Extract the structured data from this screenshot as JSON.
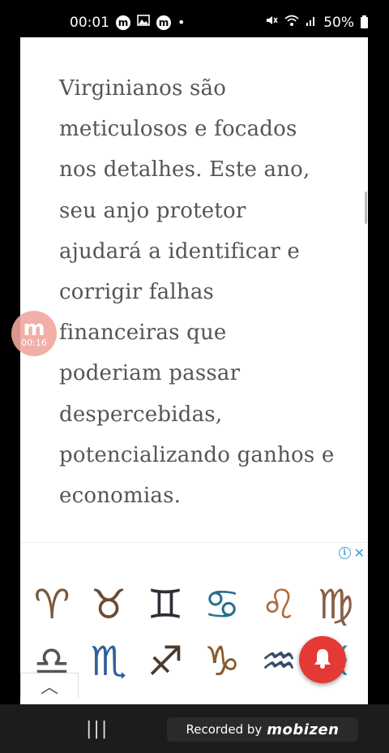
{
  "status_bar": {
    "time": "00:01",
    "dot": "•",
    "battery": "50%",
    "left_icons": [
      "mobizen-icon",
      "gallery-icon",
      "mobizen-icon"
    ],
    "right_icons": [
      "mute-icon",
      "wifi-icon",
      "signal-icon",
      "battery-icon"
    ],
    "badge_letter": "m"
  },
  "article": {
    "text": "Virginianos são meticulosos e focados nos detalhes. Este ano, seu anjo protetor ajudará a identificar e corrigir falhas financeiras que poderiam passar despercebidas, potencializando ganhos e economias."
  },
  "ad": {
    "info_glyph": "i",
    "close_glyph": "✕",
    "zodiac": [
      {
        "name": "aries-icon",
        "glyph": "♈"
      },
      {
        "name": "taurus-icon",
        "glyph": "♉"
      },
      {
        "name": "gemini-icon",
        "glyph": "♊"
      },
      {
        "name": "cancer-icon",
        "glyph": "♋"
      },
      {
        "name": "leo-icon",
        "glyph": "♌"
      },
      {
        "name": "virgo-icon",
        "glyph": "♍"
      },
      {
        "name": "libra-icon",
        "glyph": "♎"
      },
      {
        "name": "scorpio-icon",
        "glyph": "♏"
      },
      {
        "name": "sagittarius-icon",
        "glyph": "♐"
      },
      {
        "name": "capricorn-icon",
        "glyph": "♑"
      },
      {
        "name": "aquarius-icon",
        "glyph": "♒"
      },
      {
        "name": "pisces-icon",
        "glyph": "♓"
      }
    ],
    "collapse_glyph": "︿"
  },
  "overlay": {
    "mobizen_logo": "m",
    "mobizen_time": "00:16"
  },
  "navbar": {
    "recents_glyph": "|||",
    "recorded_label": "Recorded by",
    "recorded_brand": "mobizen"
  },
  "colors": {
    "bell": "#e53935",
    "mobizen_bubble": "#f0a79e",
    "ad_accent": "#3aa0d8"
  }
}
